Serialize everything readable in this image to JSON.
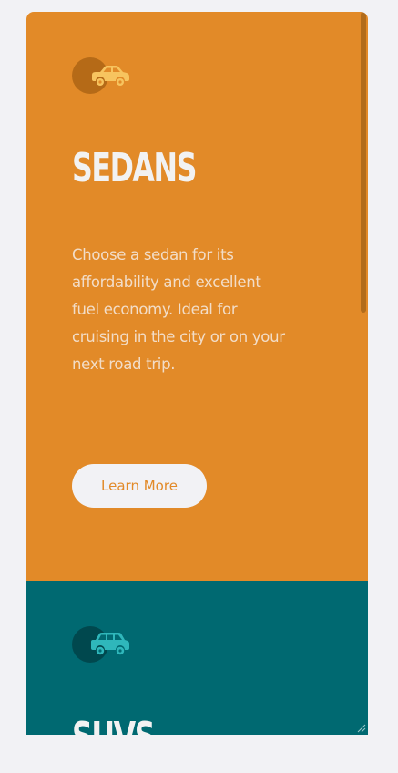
{
  "sections": [
    {
      "title": "SEDANS",
      "icon": "sedan-car-icon",
      "description": "Choose a sedan for its affordability and excellent fuel economy. Ideal for cruising in the city or on your next road trip.",
      "button_label": "Learn More",
      "colors": {
        "background": "#e28a28",
        "icon": "#f7c45f",
        "icon_circle": "#b56a17"
      }
    },
    {
      "title": "SUVS",
      "icon": "suv-car-icon",
      "colors": {
        "background": "#006971",
        "icon": "#2fb7bb",
        "icon_circle": "#00484e"
      }
    }
  ]
}
